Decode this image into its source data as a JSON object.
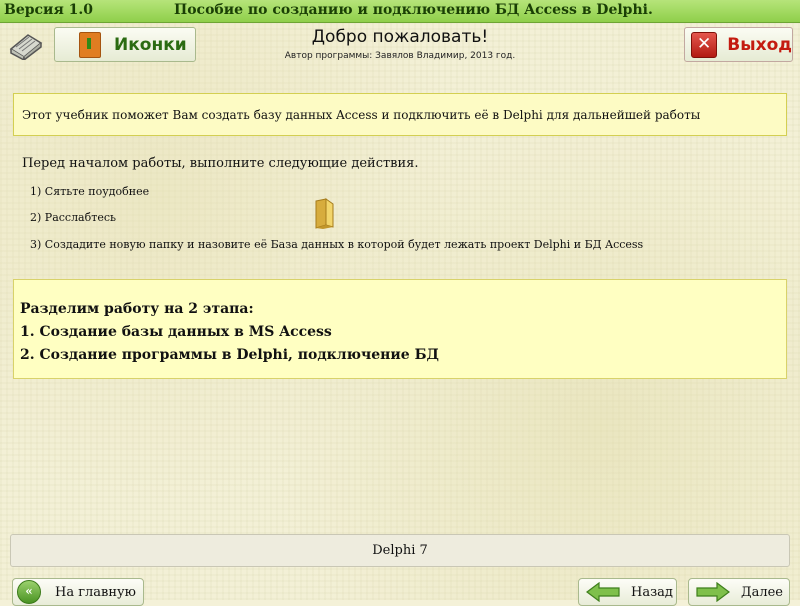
{
  "titlebar": {
    "version": "Версия 1.0",
    "title": "Пособие по созданию и подключению БД Access в Delphi."
  },
  "header": {
    "icons_button": "Иконки",
    "welcome": "Добро пожаловать!",
    "author": "Автор программы: Завялов Владимир, 2013 год.",
    "exit_button": "Выход"
  },
  "intro": "Этот учебник поможет Вам создать базу данных Access и подключить её в Delphi для дальнейшей работы",
  "before_start": "Перед началом работы, выполните следующие действия.",
  "steps": [
    "1) Сятьте поудобнее",
    "2) Расслабтесь",
    "3) Создадите новую папку и назовите её   База данных   в которой будет лежать проект Delphi и БД Access"
  ],
  "stages": {
    "heading": "Разделим работу на 2 этапа:",
    "items": [
      "1. Создание базы данных в MS Access",
      "2. Создание программы в Delphi, подключение БД"
    ]
  },
  "footer": {
    "status": "Delphi 7",
    "home_button": "На главную",
    "back_button": "Назад",
    "next_button": "Далее"
  },
  "colors": {
    "titlebar": "#9bd75a",
    "intro_bg": "#fdfbc4",
    "stages_bg": "#ffffc2",
    "exit_red": "#c41b10",
    "icons_green": "#2b6b12"
  }
}
